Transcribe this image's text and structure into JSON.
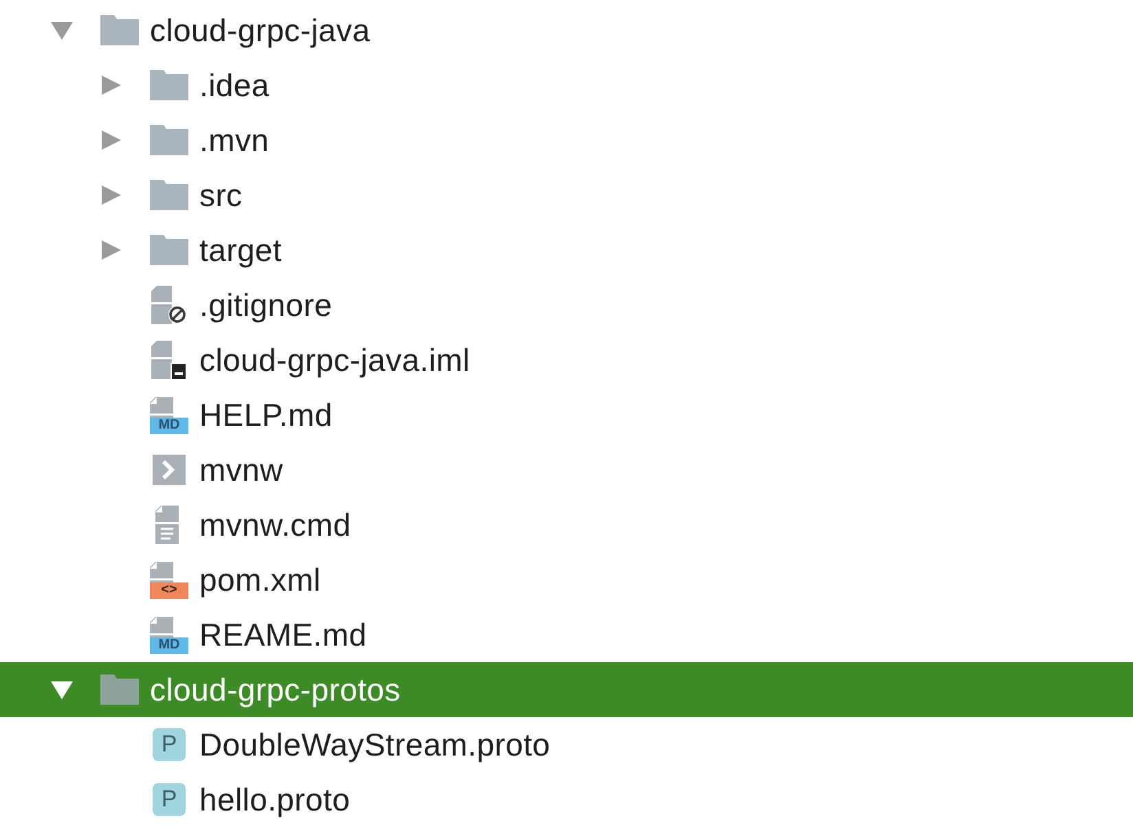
{
  "tree": [
    {
      "kind": "folder",
      "name": "cloud-grpc-java",
      "expanded": true,
      "selected": false,
      "children": [
        {
          "kind": "folder",
          "name": ".idea",
          "expanded": false,
          "selected": false
        },
        {
          "kind": "folder",
          "name": ".mvn",
          "expanded": false,
          "selected": false
        },
        {
          "kind": "folder",
          "name": "src",
          "expanded": false,
          "selected": false
        },
        {
          "kind": "folder",
          "name": "target",
          "expanded": false,
          "selected": false
        },
        {
          "kind": "ignore",
          "name": ".gitignore",
          "selected": false
        },
        {
          "kind": "iml",
          "name": "cloud-grpc-java.iml",
          "selected": false
        },
        {
          "kind": "md",
          "badge": "MD",
          "name": "HELP.md",
          "selected": false
        },
        {
          "kind": "shell",
          "name": "mvnw",
          "selected": false
        },
        {
          "kind": "text",
          "name": "mvnw.cmd",
          "selected": false
        },
        {
          "kind": "xml",
          "badge": "<>",
          "name": "pom.xml",
          "selected": false
        },
        {
          "kind": "md",
          "badge": "MD",
          "name": "REAME.md",
          "selected": false
        }
      ]
    },
    {
      "kind": "folder",
      "name": "cloud-grpc-protos",
      "expanded": true,
      "selected": true,
      "children": [
        {
          "kind": "proto",
          "badge": "P",
          "name": "DoubleWayStream.proto",
          "selected": false
        },
        {
          "kind": "proto",
          "badge": "P",
          "name": "hello.proto",
          "selected": false
        }
      ]
    }
  ]
}
